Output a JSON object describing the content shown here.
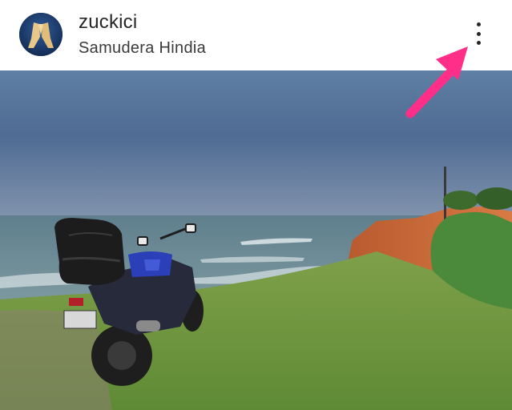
{
  "post": {
    "username": "zuckici",
    "location": "Samudera Hindia"
  },
  "icons": {
    "more": "more-options-icon",
    "annotation": "pink-arrow"
  },
  "colors": {
    "arrow": "#ff2e88",
    "text": "#262626"
  }
}
